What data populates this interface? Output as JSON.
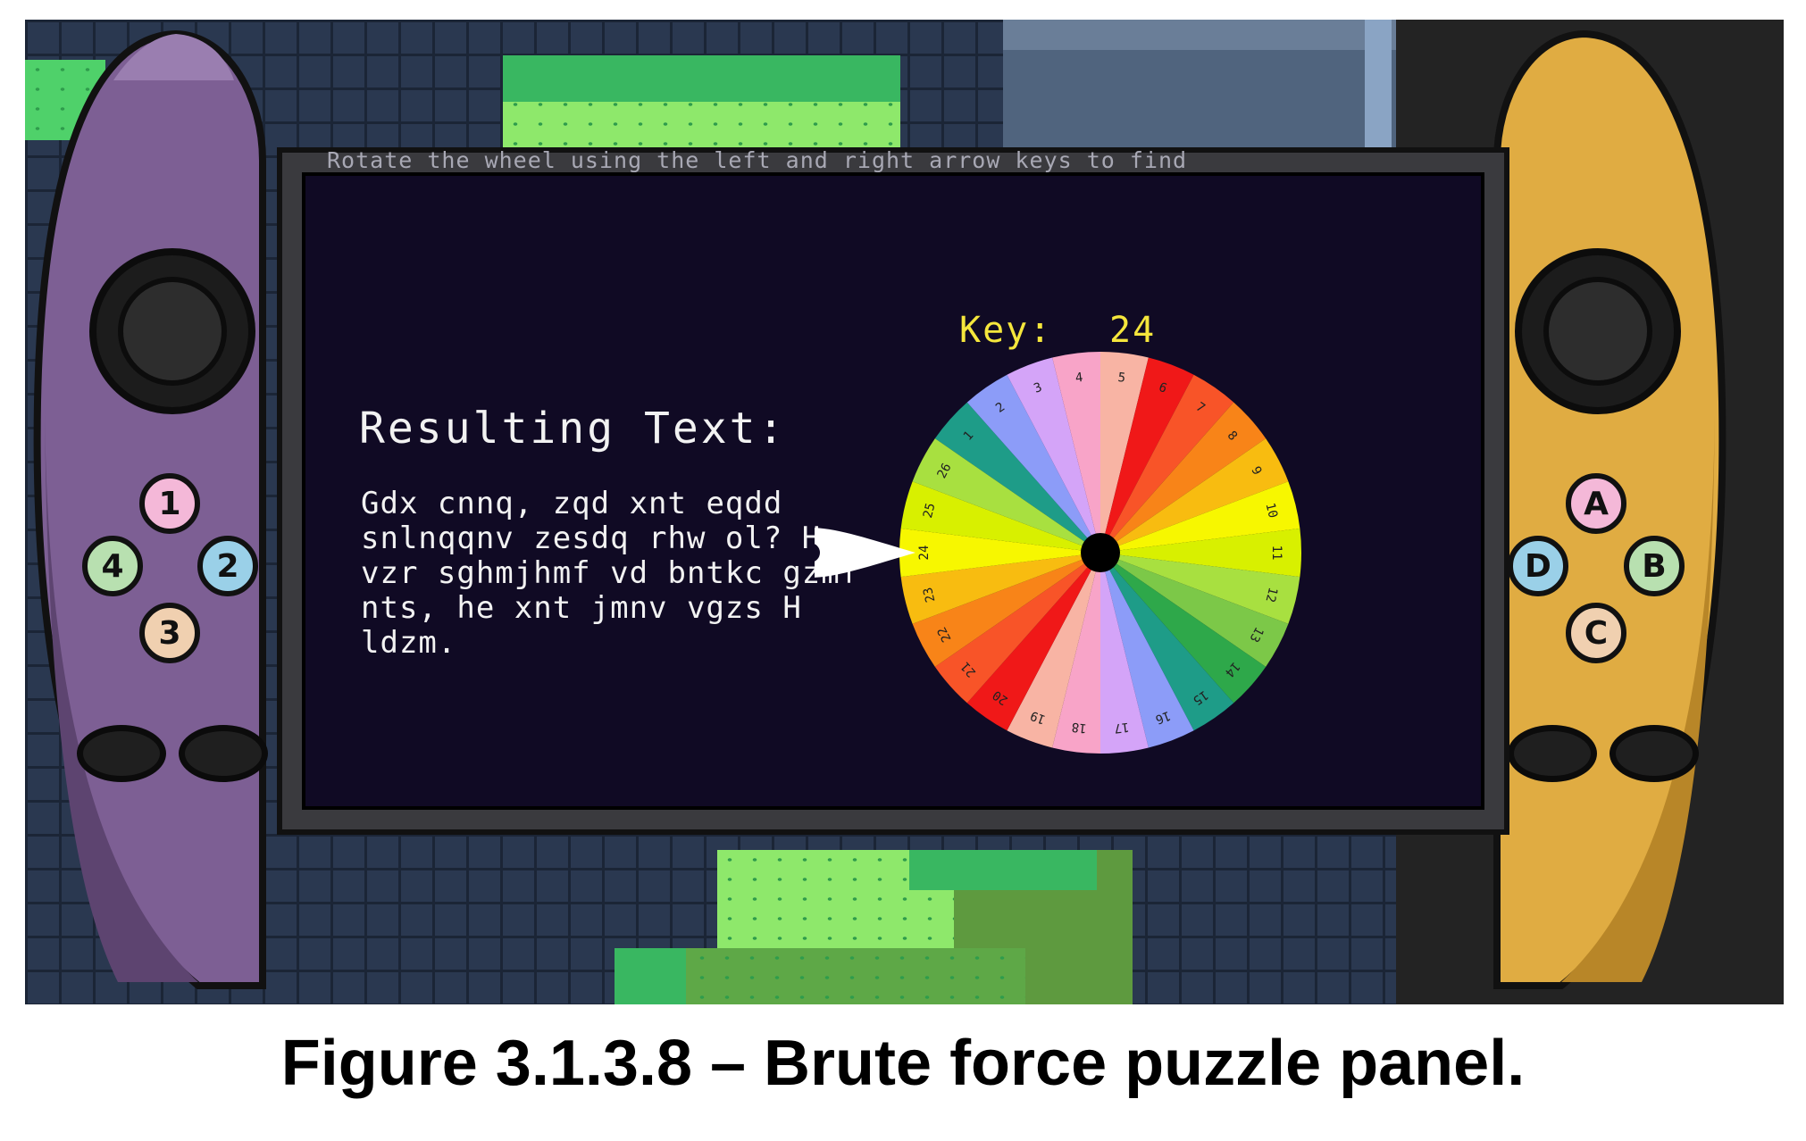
{
  "instructions": "Rotate the wheel using the left and right arrow keys to find\nthe correct key. Press enter to submit answer.",
  "result": {
    "heading": "Resulting Text:",
    "body": "Gdx cnnq, zqd xnt eqdd snlnqqnv zesdq rhw ol? H vzr sghmjhmf vd bntkc gzmf nts, he xnt jmnv vgzs H ldzm."
  },
  "key": {
    "label": "Key:",
    "value": "24"
  },
  "wheel": {
    "numbers": [
      "1",
      "2",
      "3",
      "4",
      "5",
      "6",
      "7",
      "8",
      "9",
      "10",
      "11",
      "12",
      "13",
      "14",
      "15",
      "16",
      "17",
      "18",
      "19",
      "20",
      "21",
      "22",
      "23",
      "24",
      "25",
      "26"
    ],
    "selected": "24",
    "colors": [
      "#f7f700",
      "#d8f000",
      "#a8e040",
      "#7cc848",
      "#2ea84a",
      "#1e9c88",
      "#8c9cf8",
      "#d4a4f8",
      "#f8a4c8",
      "#f8b4a4",
      "#f01818",
      "#f85428",
      "#f88418",
      "#f8bc10"
    ]
  },
  "left_controller": {
    "color": "#7d5f94",
    "buttons": [
      "1",
      "2",
      "3",
      "4"
    ]
  },
  "right_controller": {
    "color": "#e0ac42",
    "buttons": [
      "A",
      "B",
      "C",
      "D"
    ]
  },
  "caption": "Figure 3.1.3.8 – Brute force puzzle panel."
}
